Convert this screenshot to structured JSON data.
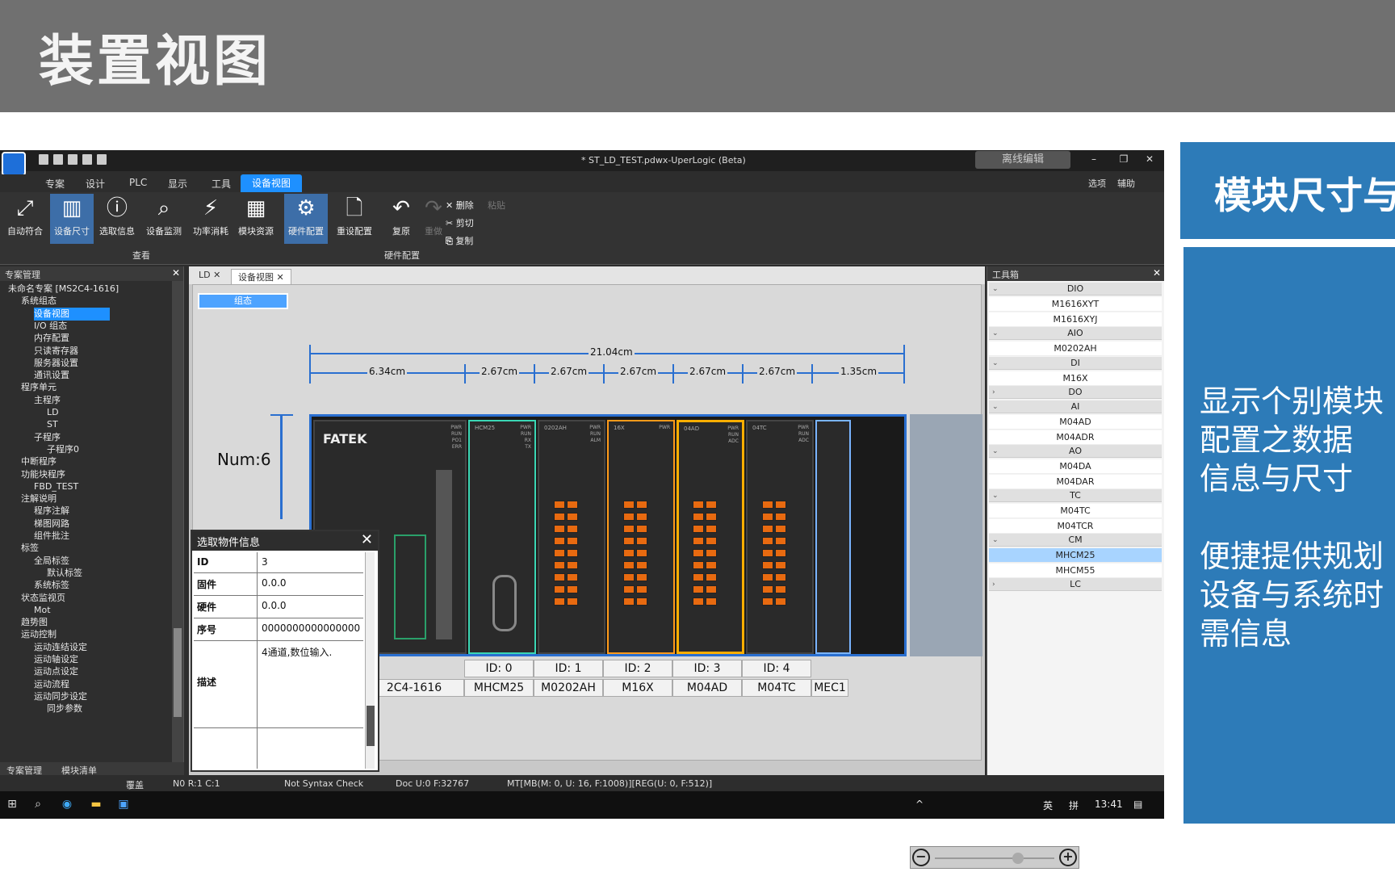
{
  "slide": {
    "title": "装置视图"
  },
  "side_panel": {
    "heading": "模块尺寸与",
    "lines": [
      "显示个别模块",
      "配置之数据",
      "信息与尺寸",
      "便捷提供规划",
      "设备与系统时",
      "需信息"
    ]
  },
  "app": {
    "window_title": "* ST_LD_TEST.pdwx-UperLogic (Beta)",
    "offline_label": "离线编辑",
    "menu": [
      "专案",
      "设计",
      "PLC",
      "显示",
      "工具",
      "设备视图"
    ],
    "menu_right": [
      "选项",
      "辅助"
    ],
    "ribbon": {
      "buttons": [
        "自动符合",
        "设备尺寸",
        "选取信息",
        "设备监测",
        "功率消耗",
        "模块资源",
        "硬件配置",
        "重设配置",
        "复原",
        "重做"
      ],
      "small": [
        "删除",
        "粘贴",
        "剪切",
        "复制"
      ],
      "groups": [
        "查看",
        "硬件配置"
      ]
    },
    "project_panel": {
      "title": "专案管理",
      "items": [
        "未命名专案 [MS2C4-1616]",
        "系统组态",
        "设备视图",
        "I/O 组态",
        "内存配置",
        "只读寄存器",
        "服务器设置",
        "通讯设置",
        "程序单元",
        "主程序",
        "LD",
        "ST",
        "子程序",
        "子程序0",
        "中断程序",
        "功能块程序",
        "FBD_TEST",
        "注解说明",
        "程序注解",
        "梯图网路",
        "组件批注",
        "标签",
        "全局标签",
        "默认标签",
        "系统标签",
        "状态监视页",
        "Mot",
        "趋势图",
        "运动控制",
        "运动连结设定",
        "运动轴设定",
        "运动点设定",
        "运动流程",
        "运动同步设定",
        "同步参数"
      ],
      "tabs": [
        "专案管理",
        "模块清单"
      ]
    },
    "tabs": [
      "LD",
      "设备视图"
    ],
    "canvas": {
      "config_button": "组态",
      "total_width": "21.04cm",
      "widths": [
        "6.34cm",
        "2.67cm",
        "2.67cm",
        "2.67cm",
        "2.67cm",
        "2.67cm",
        "1.35cm"
      ],
      "num_label": "Num:6",
      "brand": "FATEK",
      "modules": [
        {
          "id": "",
          "name": "2C4-1616"
        },
        {
          "id": "ID: 0",
          "name": "MHCM25"
        },
        {
          "id": "ID: 1",
          "name": "M0202AH"
        },
        {
          "id": "ID: 2",
          "name": "M16X"
        },
        {
          "id": "ID: 3",
          "name": "M04AD"
        },
        {
          "id": "ID: 4",
          "name": "M04TC"
        },
        {
          "id": "",
          "name": "MEC1"
        }
      ],
      "module_labels": [
        "HCM25",
        "0202AH",
        "16X",
        "04AD",
        "04TC"
      ]
    },
    "dialog": {
      "title": "选取物件信息",
      "rows": [
        {
          "k": "ID",
          "v": "3"
        },
        {
          "k": "固件",
          "v": "0.0.0"
        },
        {
          "k": "硬件",
          "v": "0.0.0"
        },
        {
          "k": "序号",
          "v": "0000000000000000"
        },
        {
          "k": "描述",
          "v": "4通道,数位输入."
        }
      ]
    },
    "toolbox": {
      "title": "工具箱",
      "entries": [
        {
          "type": "g",
          "label": "DIO"
        },
        {
          "type": "i",
          "label": "M1616XYT"
        },
        {
          "type": "i",
          "label": "M1616XYJ"
        },
        {
          "type": "g",
          "label": "AIO"
        },
        {
          "type": "i",
          "label": "M0202AH"
        },
        {
          "type": "g",
          "label": "DI"
        },
        {
          "type": "i",
          "label": "M16X"
        },
        {
          "type": "g",
          "label": "DO"
        },
        {
          "type": "g",
          "label": "AI"
        },
        {
          "type": "i",
          "label": "M04AD"
        },
        {
          "type": "i",
          "label": "M04ADR"
        },
        {
          "type": "g",
          "label": "AO"
        },
        {
          "type": "i",
          "label": "M04DA"
        },
        {
          "type": "i",
          "label": "M04DAR"
        },
        {
          "type": "g",
          "label": "TC"
        },
        {
          "type": "i",
          "label": "M04TC"
        },
        {
          "type": "i",
          "label": "M04TCR"
        },
        {
          "type": "g",
          "label": "CM"
        },
        {
          "type": "i",
          "label": "MHCM25",
          "selected": true
        },
        {
          "type": "i",
          "label": "MHCM55"
        },
        {
          "type": "g",
          "label": "LC"
        }
      ]
    },
    "status": [
      "覆盖",
      "N0 R:1 C:1",
      "Not Syntax Check",
      "Doc U:0 F:32767",
      "MT[MB(M: 0, U: 16, F:1008)][REG(U: 0, F:512)]"
    ],
    "taskbar": {
      "lang": "英",
      "ime": "拼",
      "time": "13:41"
    }
  }
}
